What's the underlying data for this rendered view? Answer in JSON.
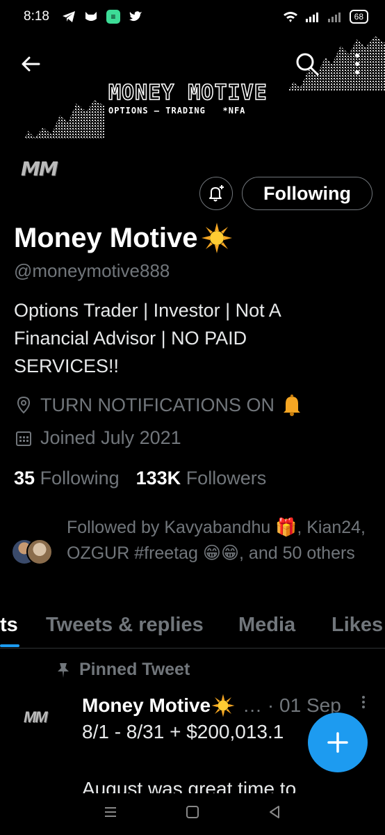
{
  "status_bar": {
    "time": "8:18",
    "battery": "68"
  },
  "header": {
    "brand_title": "MONEY MOTIVE",
    "brand_subtitle": "OPTIONS — TRADING   *NFA",
    "avatar_text": "MM"
  },
  "profile": {
    "following_button": "Following",
    "name": "Money Motive",
    "handle": "@moneymotive888",
    "bio": "Options Trader | Investor | Not A Financial Advisor | NO PAID SERVICES!!",
    "location": "TURN NOTIFICATIONS ON",
    "joined": "Joined July 2021",
    "following_count": "35",
    "following_label": "Following",
    "followers_count": "133K",
    "followers_label": "Followers",
    "followed_by": "Followed by Kavyabandhu 🎁, Kian24, OZGUR #freetag 😁😁, and 50 others"
  },
  "tabs": [
    {
      "label": "ts"
    },
    {
      "label": "Tweets & replies"
    },
    {
      "label": "Media"
    },
    {
      "label": "Likes"
    }
  ],
  "pinned_tweet": {
    "pinned_label": "Pinned Tweet",
    "avatar_text": "MM",
    "author": "Money Motive",
    "meta": "… · 01 Sep",
    "body_line1": "8/1 - 8/31 + $200,013.1",
    "body_line2": "August was great time to"
  },
  "colors": {
    "accent": "#1d9bf0",
    "muted": "#71767b",
    "background": "#000000"
  }
}
